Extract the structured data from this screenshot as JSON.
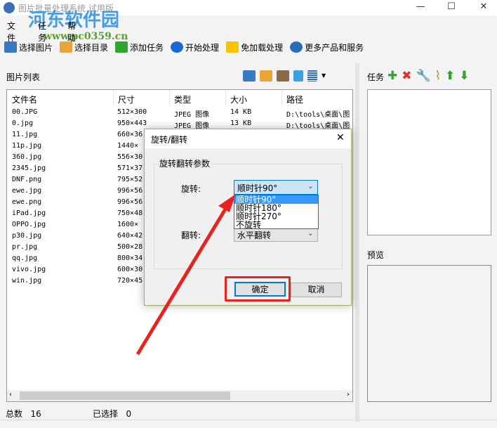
{
  "window": {
    "title": "图片批量处理系统 试用版",
    "minimize": "—",
    "maximize": "☐",
    "close": "✕"
  },
  "watermark": {
    "name": "河东软件园",
    "url": "www.pc0359.cn"
  },
  "menu": [
    "文件",
    "任务",
    "帮助"
  ],
  "toolbar": [
    {
      "label": "选择图片",
      "icon": "image-icon",
      "color": "#3a78c2"
    },
    {
      "label": "选择目录",
      "icon": "folder-icon",
      "color": "#e8a53a"
    },
    {
      "label": "添加任务",
      "icon": "plus-icon",
      "color": "#2fa52f"
    },
    {
      "label": "开始处理",
      "icon": "play-icon",
      "color": "#1a66d6"
    },
    {
      "label": "免加载处理",
      "icon": "lightning-icon",
      "color": "#f5c500"
    },
    {
      "label": "更多产品和服务",
      "icon": "globe-icon",
      "color": "#2b6cb8"
    }
  ],
  "left_panel": {
    "title": "图片列表"
  },
  "list": {
    "columns": [
      "文件名",
      "尺寸",
      "类型",
      "大小",
      "路径"
    ],
    "rows": [
      [
        "00.JPG",
        "512×300",
        "JPEG 图像",
        "14 KB",
        "D:\\tools\\桌面\\图"
      ],
      [
        "0.jpg",
        "950×443",
        "JPEG 图像",
        "13 KB",
        "D:\\tools\\桌面\\图"
      ],
      [
        "11.jpg",
        "660×36",
        "",
        "",
        ""
      ],
      [
        "11p.jpg",
        "1440×",
        "",
        "",
        ""
      ],
      [
        "360.jpg",
        "556×30",
        "",
        "",
        ""
      ],
      [
        "2345.jpg",
        "571×37",
        "",
        "",
        ""
      ],
      [
        "DNF.png",
        "795×52",
        "",
        "",
        ""
      ],
      [
        "ewe.jpg",
        "996×56",
        "",
        "",
        ""
      ],
      [
        "ewe.png",
        "996×56",
        "",
        "",
        ""
      ],
      [
        "iPad.jpg",
        "750×48",
        "",
        "",
        ""
      ],
      [
        "OPPO.jpg",
        "1600×",
        "",
        "",
        ""
      ],
      [
        "p30.jpg",
        "640×42",
        "",
        "",
        ""
      ],
      [
        "pr.jpg",
        "500×28",
        "",
        "",
        ""
      ],
      [
        "qq.jpg",
        "800×34",
        "",
        "",
        ""
      ],
      [
        "vivo.jpg",
        "600×30",
        "",
        "",
        ""
      ],
      [
        "win.jpg",
        "720×45",
        "",
        "",
        ""
      ]
    ]
  },
  "status": {
    "total_label": "总数",
    "total": "16",
    "selected_label": "已选择",
    "selected": "0"
  },
  "right_panel": {
    "task_title": "任务",
    "preview_title": "预览"
  },
  "dialog": {
    "title": "旋转/翻转",
    "close": "✕",
    "group": "旋转翻转参数",
    "rotate_label": "旋转:",
    "rotate_value": "顺时针90°",
    "rotate_options": [
      "顺时针90°",
      "顺时针180°",
      "顺时针270°",
      "不旋转"
    ],
    "flip_label": "翻转:",
    "flip_value": "水平翻转",
    "ok": "确定",
    "cancel": "取消"
  },
  "annotation_color": "#e8231f"
}
